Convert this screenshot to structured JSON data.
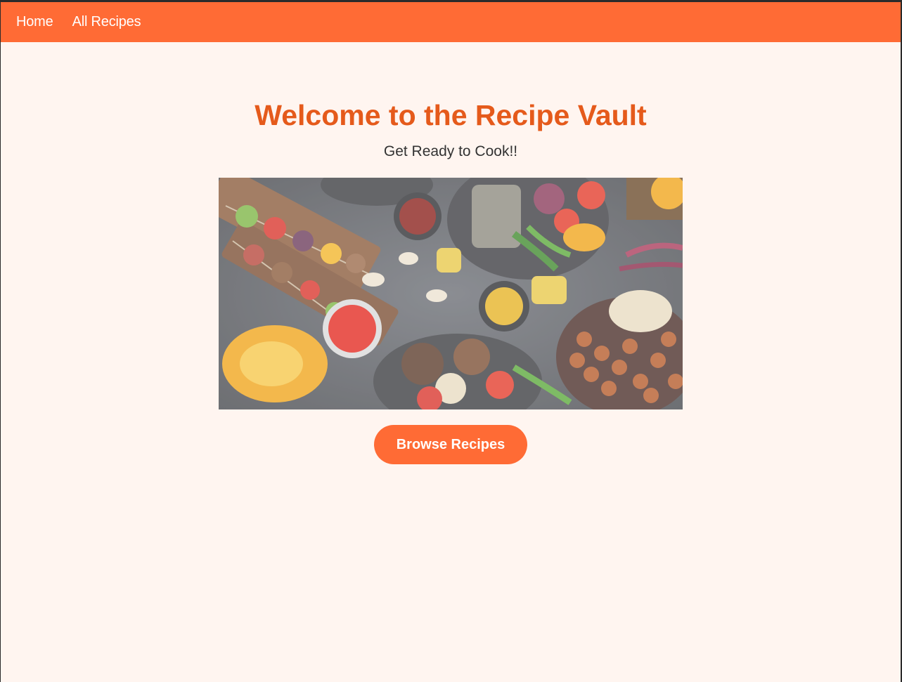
{
  "nav": {
    "items": [
      {
        "label": "Home"
      },
      {
        "label": "All Recipes"
      }
    ]
  },
  "hero": {
    "title": "Welcome to the Recipe Vault",
    "subtitle": "Get Ready to Cook!!",
    "button_label": "Browse Recipes"
  },
  "colors": {
    "brand": "#ff6b35",
    "title": "#e55a1b",
    "background": "#fff5f0"
  }
}
